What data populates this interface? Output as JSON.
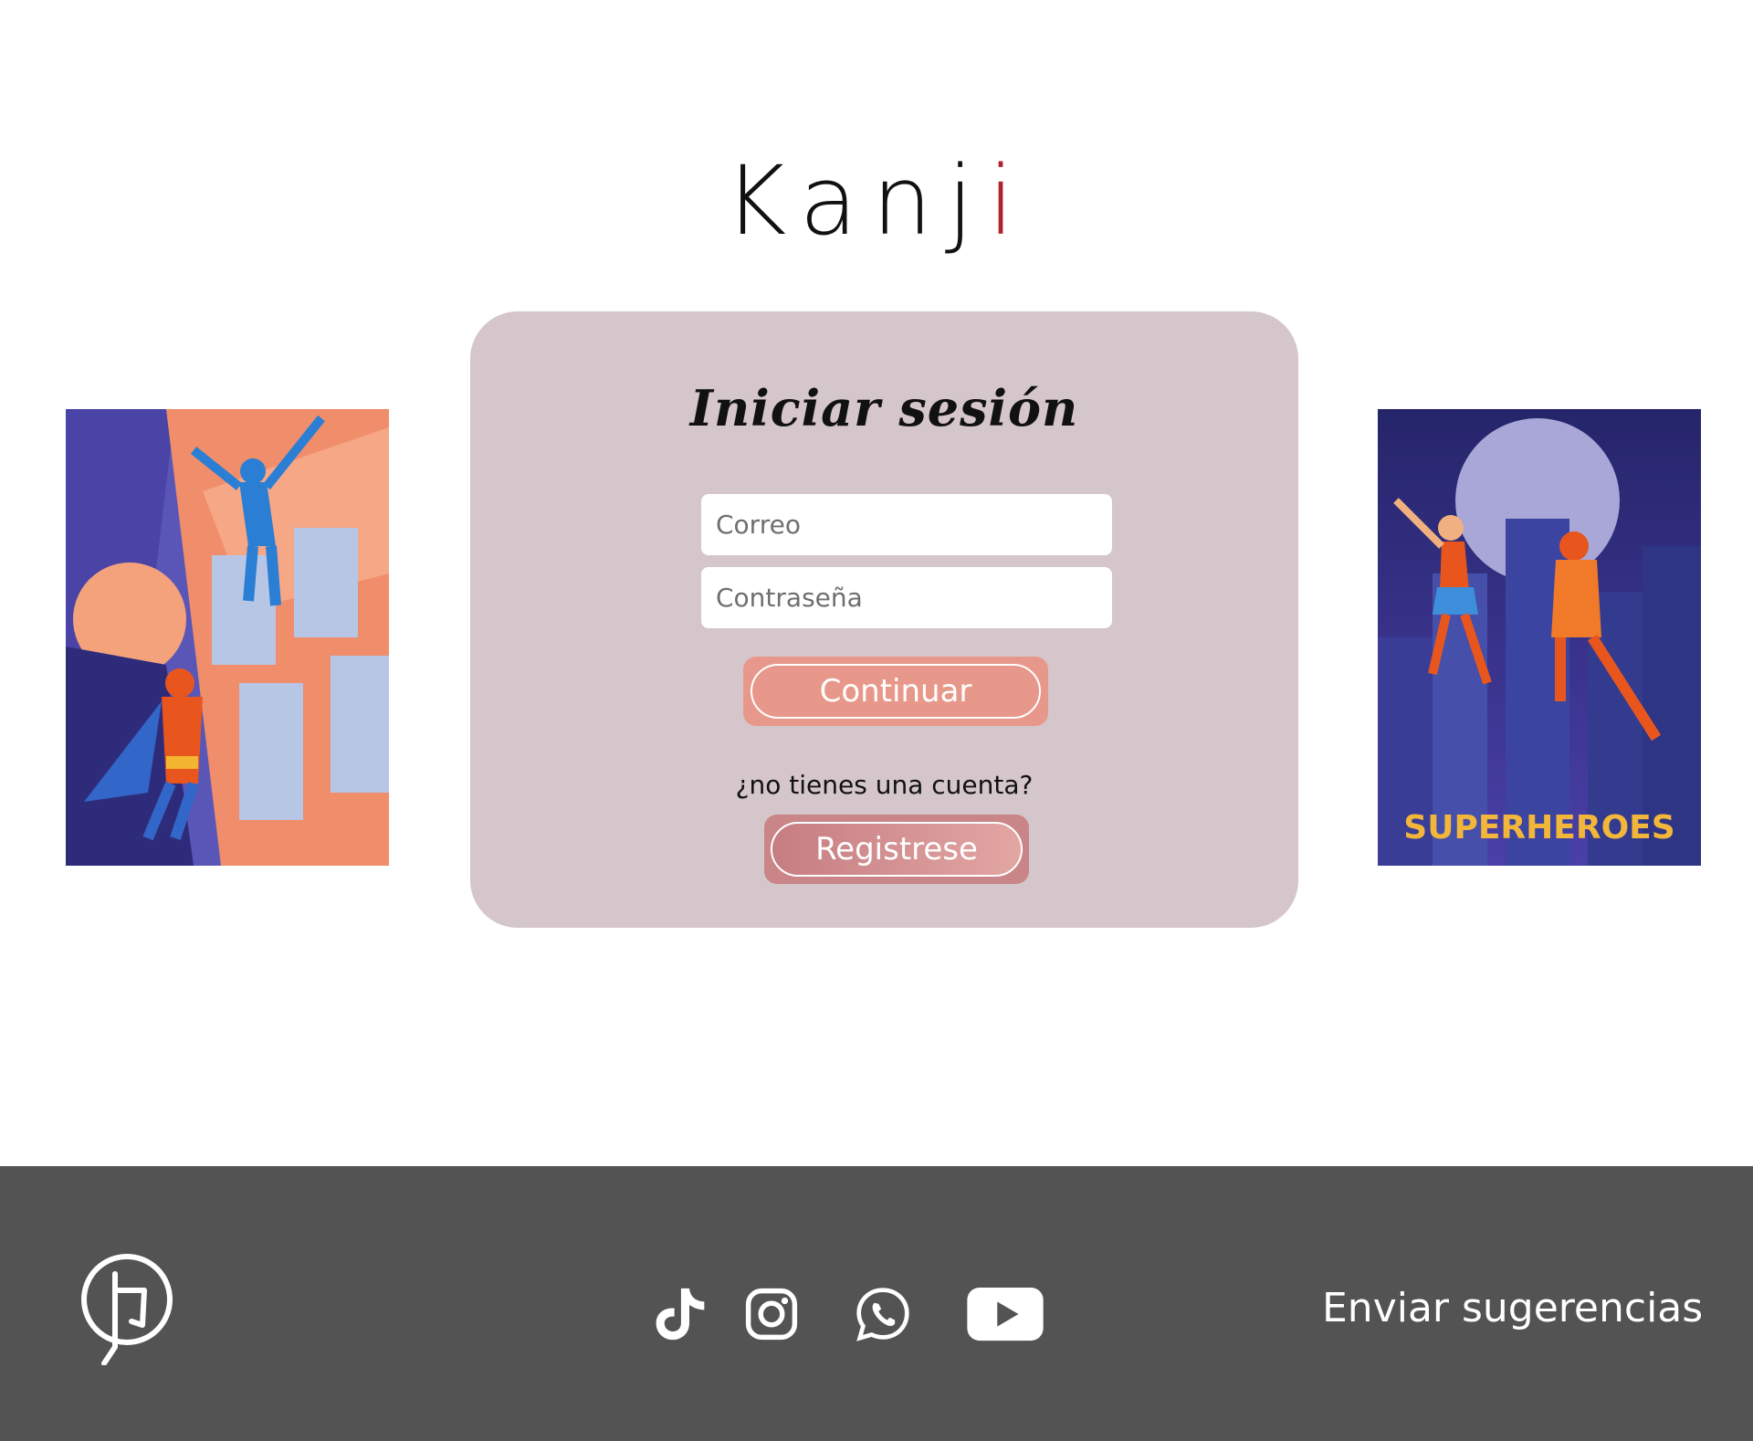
{
  "brand": {
    "name_main": "Kanj",
    "name_dot_letter": "i"
  },
  "login": {
    "title": "Iniciar sesión",
    "email_placeholder": "Correo",
    "password_placeholder": "Contraseña",
    "continue_label": "Continuar",
    "no_account_prompt": "¿no tienes una cuenta?",
    "register_label": "Registrese"
  },
  "art": {
    "right_caption": "SUPERHEROES"
  },
  "footer": {
    "social_icons": [
      "tiktok-icon",
      "instagram-icon",
      "whatsapp-icon",
      "youtube-icon"
    ],
    "suggestions_label": "Enviar sugerencias"
  },
  "colors": {
    "card_bg": "#d4c6ca",
    "continue_btn": "#e8988a",
    "register_btn": "#c98587",
    "footer_bg": "#535353",
    "brand_accent": "#b0202c"
  }
}
